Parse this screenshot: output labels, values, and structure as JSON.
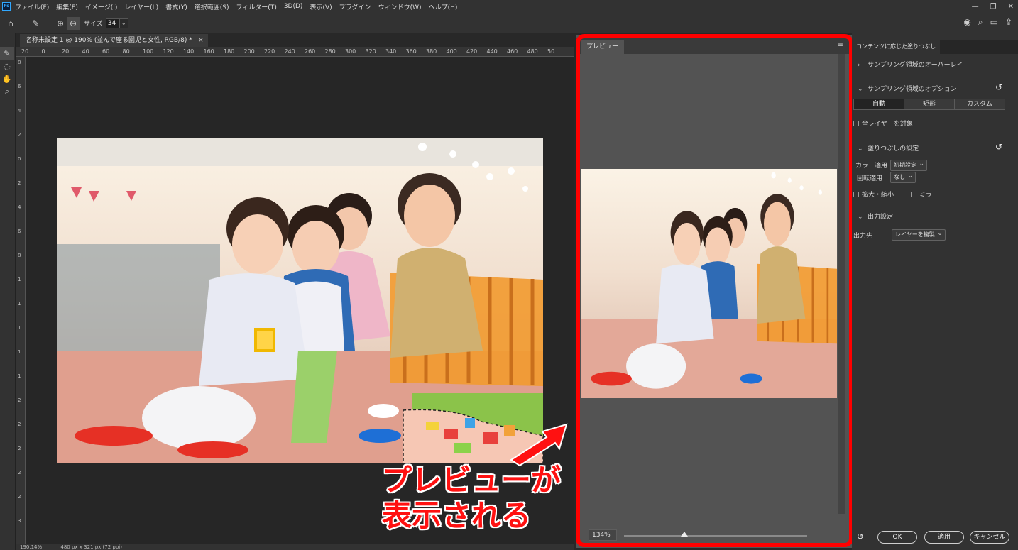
{
  "menubar": {
    "items": [
      "ファイル(F)",
      "編集(E)",
      "イメージ(I)",
      "レイヤー(L)",
      "書式(Y)",
      "選択範囲(S)",
      "フィルター(T)",
      "3D(D)",
      "表示(V)",
      "プラグイン",
      "ウィンドウ(W)",
      "ヘルプ(H)"
    ],
    "logo": "Ps"
  },
  "options": {
    "size_label": "サイズ",
    "size_value": "34"
  },
  "document": {
    "tab_title": "名称未設定 1 @ 190% (並んで座る園児と女性, RGB/8) *",
    "status_zoom": "190.14%",
    "status_dims": "480 px x 321 px (72 ppi)"
  },
  "ruler_h": [
    "20",
    "0",
    "20",
    "40",
    "60",
    "80",
    "100",
    "120",
    "140",
    "160",
    "180",
    "200",
    "220",
    "240",
    "260",
    "280",
    "300",
    "320",
    "340",
    "360",
    "380",
    "400",
    "420",
    "440",
    "460",
    "480",
    "50"
  ],
  "ruler_v": [
    "8",
    "6",
    "4",
    "2",
    "0",
    "2",
    "4",
    "6",
    "8",
    "1",
    "1",
    "1",
    "1",
    "1",
    "2",
    "2",
    "2",
    "2",
    "2",
    "3"
  ],
  "preview": {
    "tab_label": "プレビュー",
    "zoom_value": "134%",
    "zoom_fraction": 0.33
  },
  "right_panel": {
    "tab_label": "コンテンツに応じた塗りつぶし",
    "sampling_overlay": "サンプリング領域のオーバーレイ",
    "sampling_options": "サンプリング領域のオプション",
    "segments": [
      "自動",
      "矩形",
      "カスタム"
    ],
    "all_layers": "全レイヤーを対象",
    "fill_settings": "塗りつぶしの設定",
    "color_adapt_label": "カラー適用",
    "color_adapt_value": "初期設定",
    "rotation_label": "回転適用",
    "rotation_value": "なし",
    "scale": "拡大・縮小",
    "mirror": "ミラー",
    "output_settings": "出力設定",
    "output_to_label": "出力先",
    "output_to_value": "レイヤーを複製",
    "ok": "OK",
    "apply": "適用",
    "cancel": "キャンセル"
  },
  "annotation": {
    "line1": "プレビューが",
    "line2": "表示される",
    "color": "#ff0000"
  },
  "colors": {
    "panel": "#535353",
    "ui": "#323232",
    "accent": "#ff0000"
  }
}
